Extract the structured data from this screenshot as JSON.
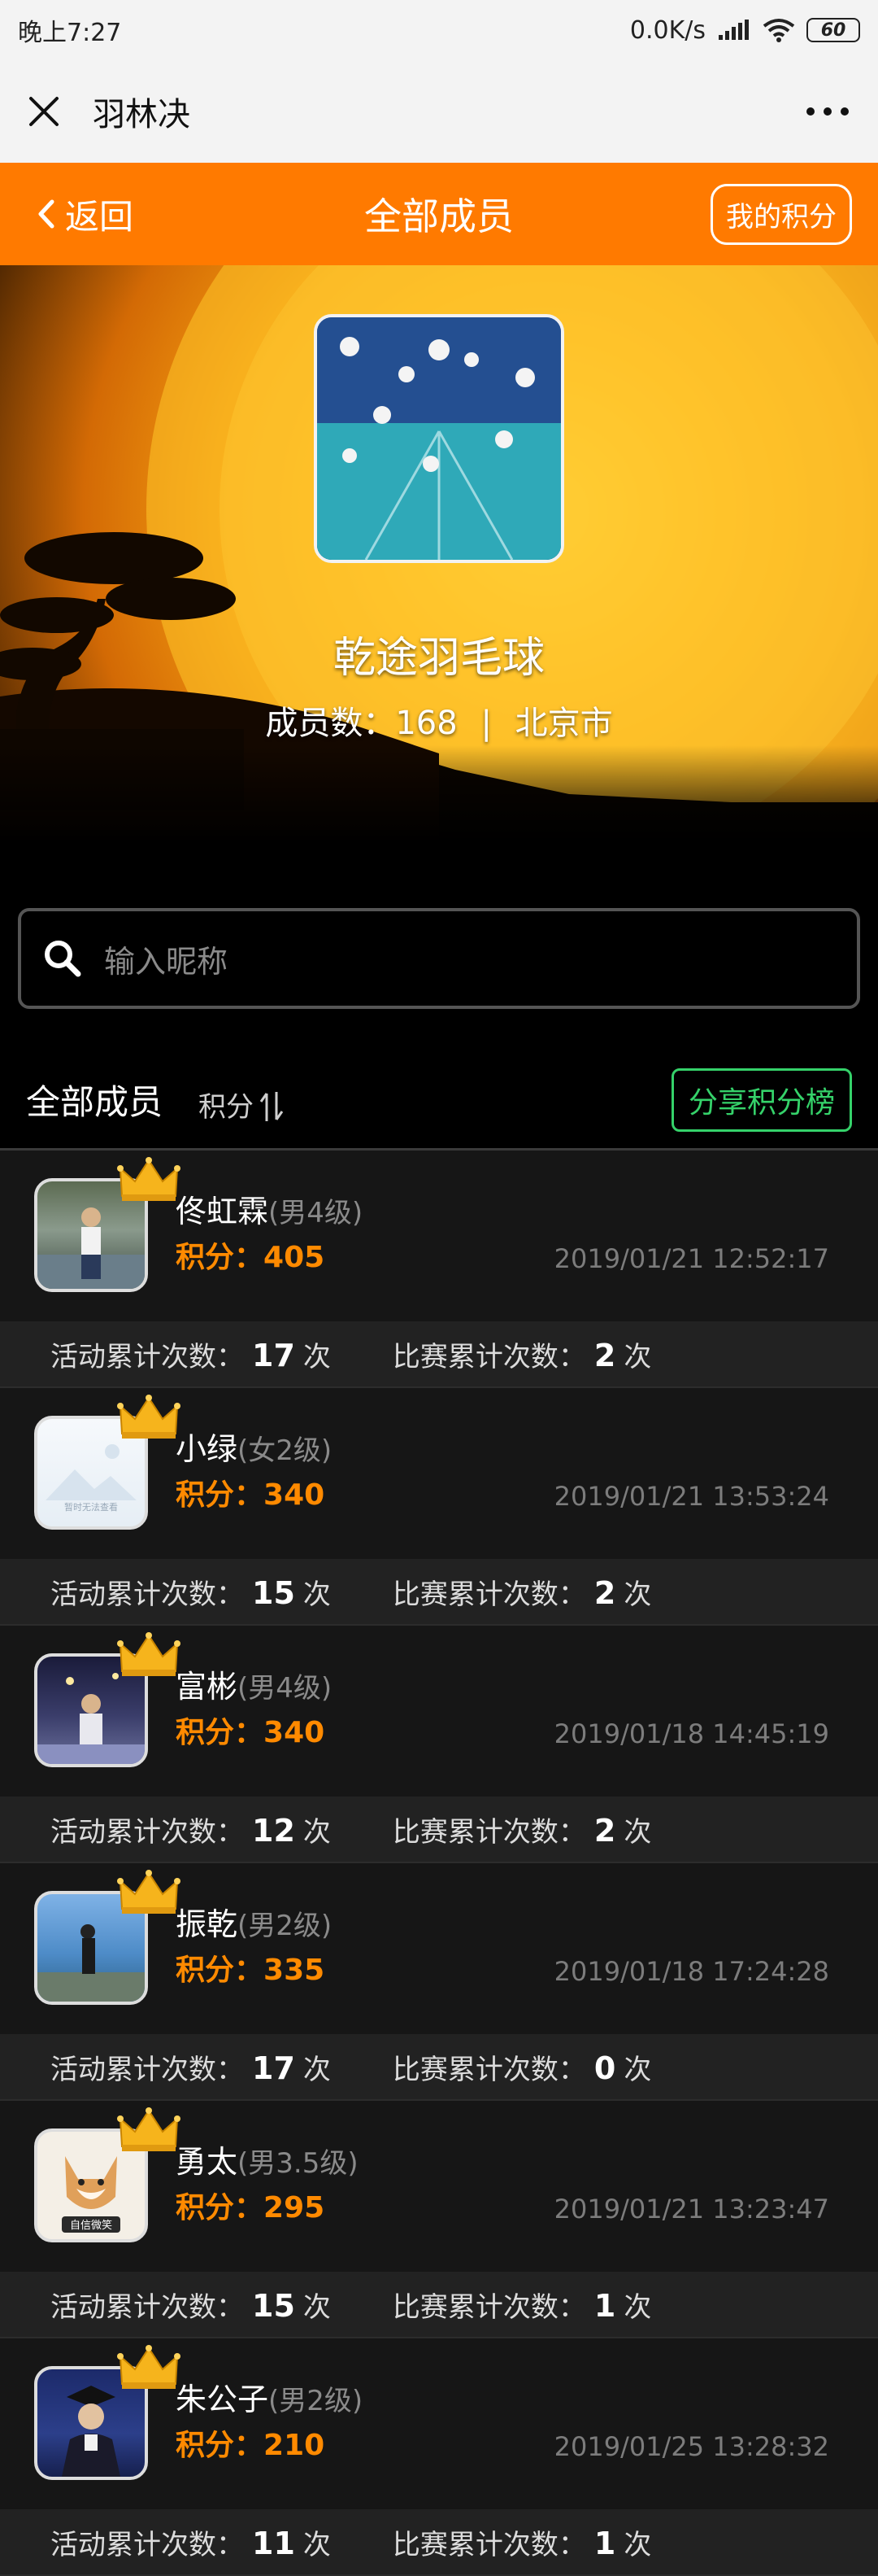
{
  "status_bar": {
    "time": "晚上7:27",
    "network_speed": "0.0K/s",
    "battery": "60"
  },
  "app_bar": {
    "title": "羽林决"
  },
  "header": {
    "back_label": "返回",
    "title": "全部成员",
    "my_points_label": "我的积分"
  },
  "group": {
    "name": "乾途羽毛球",
    "member_count_label": "成员数",
    "member_count": "168",
    "separator": "|",
    "city": "北京市"
  },
  "search": {
    "placeholder": "输入昵称"
  },
  "section": {
    "title": "全部成员",
    "sort_label": "积分",
    "share_label": "分享积分榜"
  },
  "labels": {
    "points_prefix": "积分：",
    "activity_label": "活动累计次数：",
    "match_label": "比赛累计次数：",
    "times_unit": "次"
  },
  "members": [
    {
      "name": "佟虹霖",
      "level": "(男4级)",
      "points": "405",
      "time": "2019/01/21 12:52:17",
      "activities": "17",
      "matches": "2"
    },
    {
      "name": "小绿",
      "level": "(女2级)",
      "points": "340",
      "time": "2019/01/21 13:53:24",
      "activities": "15",
      "matches": "2",
      "avatar_text": "暂时无法查看"
    },
    {
      "name": "富彬",
      "level": "(男4级)",
      "points": "340",
      "time": "2019/01/18 14:45:19",
      "activities": "12",
      "matches": "2"
    },
    {
      "name": "振乾",
      "level": "(男2级)",
      "points": "335",
      "time": "2019/01/18 17:24:28",
      "activities": "17",
      "matches": "0"
    },
    {
      "name": "勇太",
      "level": "(男3.5级)",
      "points": "295",
      "time": "2019/01/21 13:23:47",
      "activities": "15",
      "matches": "1",
      "avatar_text": "自信微笑"
    },
    {
      "name": "朱公子",
      "level": "(男2级)",
      "points": "210",
      "time": "2019/01/25 13:28:32",
      "activities": "11",
      "matches": "1"
    }
  ],
  "colors": {
    "accent_orange": "#ff7a00",
    "points_orange": "#ff8a00",
    "share_green": "#35d26a"
  }
}
